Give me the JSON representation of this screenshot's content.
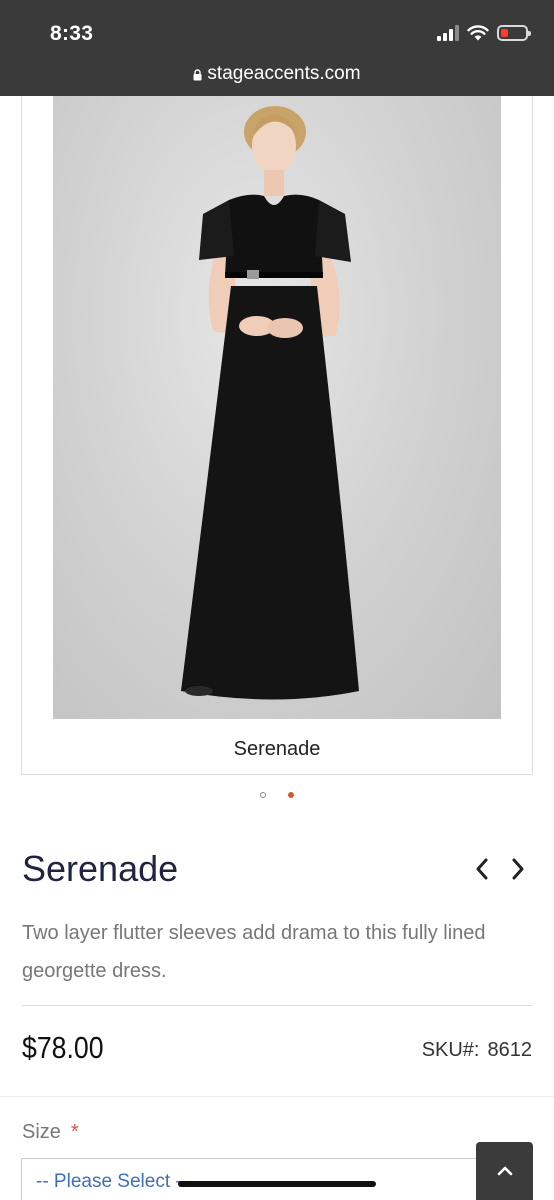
{
  "status_bar": {
    "time": "8:33",
    "battery_level": 0.3
  },
  "browser": {
    "url": "stageaccents.com"
  },
  "gallery": {
    "image_alt": "Serenade",
    "caption": "Serenade",
    "dots": 2,
    "active_dot": 1,
    "dot_active_color": "#d35a2b"
  },
  "product": {
    "title": "Serenade",
    "prev_icon": "chevron-left-icon",
    "next_icon": "chevron-right-icon",
    "description": "Two layer flutter sleeves add drama to this fully lined georgette dress.",
    "price": "$78.00",
    "sku_label": "SKU#:",
    "sku_value": "8612"
  },
  "options": {
    "size_label": "Size",
    "required_mark": "*",
    "size_select_value": "-- Please Select --"
  },
  "back_to_top_icon": "chevron-up-icon",
  "colors": {
    "title": "#1f2540",
    "link_blue": "#3f6fb5",
    "required_red": "#d9534f",
    "header_bg": "#3a3a3a"
  }
}
